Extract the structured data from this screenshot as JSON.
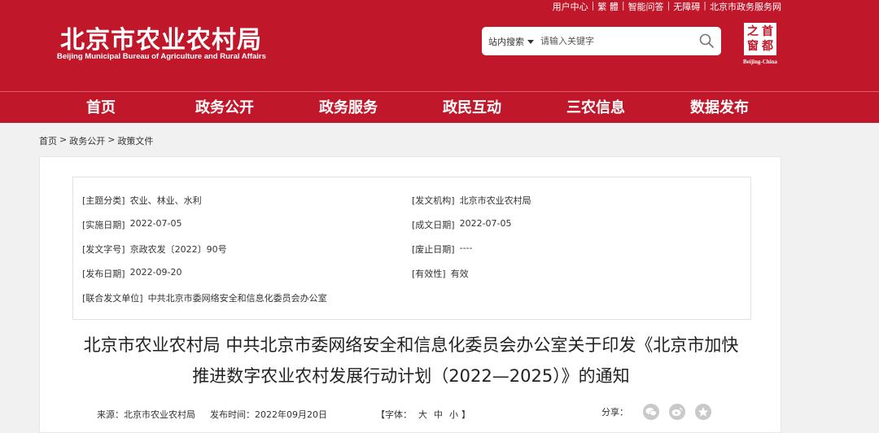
{
  "header": {
    "toplinks": [
      "用户中心",
      "|",
      "繁 體",
      "|",
      "智能问答",
      "|",
      "无障碍",
      "|",
      "北京市政务服务网"
    ],
    "logo_cn": "北京市农业农村局",
    "logo_en": "Beijing Municipal Bureau of Agriculture and Rural Affairs",
    "search_scope": "站内搜索",
    "search_placeholder": "请输入关键字",
    "seal_chars": [
      "之",
      "首",
      "窗",
      "都"
    ],
    "seal_en": "Beijing-China"
  },
  "nav": [
    "首页",
    "政务公开",
    "政务服务",
    "政民互动",
    "三农信息",
    "数据发布"
  ],
  "breadcrumb": [
    "首页",
    ">",
    "政务公开",
    ">",
    "政策文件"
  ],
  "meta": {
    "theme": {
      "label": "[主题分类]",
      "value": "农业、林业、水利"
    },
    "issuer": {
      "label": "[发文机构]",
      "value": "北京市农业农村局"
    },
    "impl_date": {
      "label": "[实施日期]",
      "value": "2022-07-05"
    },
    "written_date": {
      "label": "[成文日期]",
      "value": "2022-07-05"
    },
    "doc_no": {
      "label": "[发文字号]",
      "value": "京政农发〔2022〕90号"
    },
    "abolish_date": {
      "label": "[废止日期]",
      "value": "----"
    },
    "publish_date": {
      "label": "[发布日期]",
      "value": "2022-09-20"
    },
    "validity": {
      "label": "[有效性]",
      "value": "有效"
    },
    "joint": {
      "label": "[联合发文单位]",
      "value": "中共北京市委网络安全和信息化委员会办公室"
    }
  },
  "title_line1": "北京市农业农村局 中共北京市委网络安全和信息化委员会办公室关于印发《北京市加快",
  "title_line2": "推进数字农业农村发展行动计划（2022—2025）》的通知",
  "info": {
    "source_label": "来源：",
    "source": "北京市农业农村局",
    "time_label": "发布时间：",
    "time": "2022年09月20日",
    "font_label": "【字体：",
    "font_large": "大",
    "font_medium": "中",
    "font_small": "小",
    "font_end": "】",
    "share_label": "分享："
  }
}
